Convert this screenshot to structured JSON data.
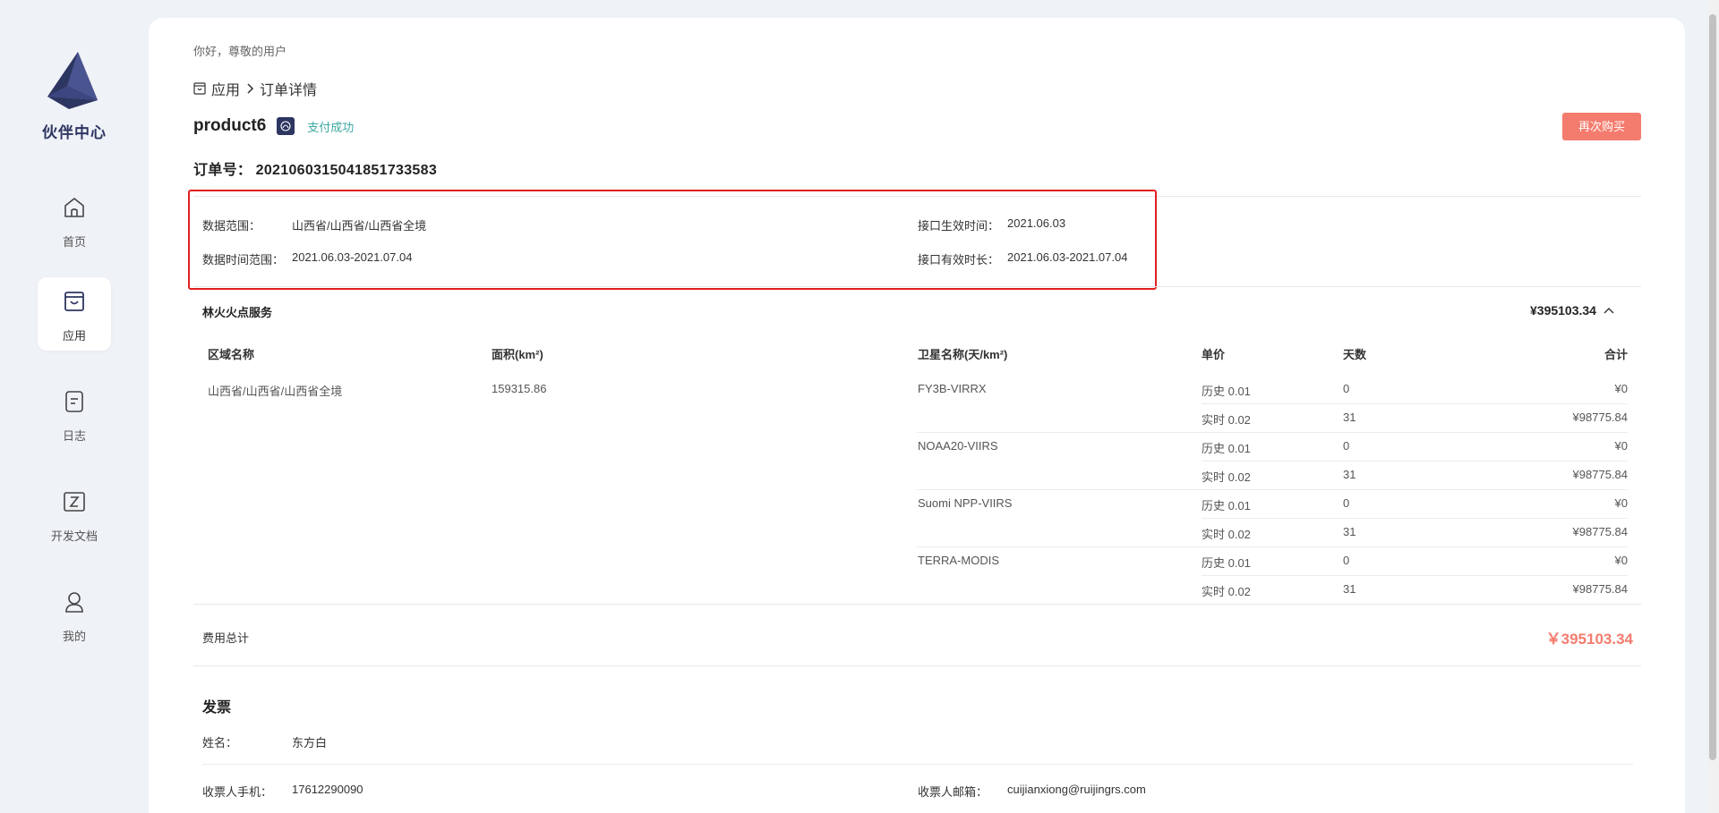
{
  "sidebar": {
    "brand": "伙伴中心",
    "items": [
      {
        "label": "首页",
        "icon": "home-icon"
      },
      {
        "label": "应用",
        "icon": "bag-icon",
        "active": true
      },
      {
        "label": "日志",
        "icon": "log-icon"
      },
      {
        "label": "开发文档",
        "icon": "doc-icon"
      },
      {
        "label": "我的",
        "icon": "user-icon"
      }
    ]
  },
  "header": {
    "greeting": "你好，尊敬的用户",
    "breadcrumb": {
      "root": "应用",
      "current": "订单详情"
    }
  },
  "product": {
    "name": "product6",
    "status": "支付成功",
    "rebuy_label": "再次购买"
  },
  "order": {
    "label": "订单号：",
    "number": "2021060315041851733583"
  },
  "info": {
    "data_range_label": "数据范围：",
    "data_range": "山西省/山西省/山西省全境",
    "data_time_label": "数据时间范围：",
    "data_time": "2021.06.03-2021.07.04",
    "api_start_label": "接口生效时间：",
    "api_start": "2021.06.03",
    "api_duration_label": "接口有效时长：",
    "api_duration": "2021.06.03-2021.07.04"
  },
  "service": {
    "title": "林火火点服务",
    "total": "¥395103.34",
    "headers": {
      "region": "区域名称",
      "area": "面积(km²)",
      "satellite": "卫星名称(天/km²)",
      "price": "单价",
      "days": "天数",
      "sum": "合计"
    },
    "region": "山西省/山西省/山西省全境",
    "area": "159315.86",
    "satellites": [
      {
        "name": "FY3B-VIRRX",
        "rows": [
          {
            "price": "历史 0.01",
            "days": "0",
            "sum": "¥0"
          },
          {
            "price": "实时 0.02",
            "days": "31",
            "sum": "¥98775.84"
          }
        ]
      },
      {
        "name": "NOAA20-VIIRS",
        "rows": [
          {
            "price": "历史 0.01",
            "days": "0",
            "sum": "¥0"
          },
          {
            "price": "实时 0.02",
            "days": "31",
            "sum": "¥98775.84"
          }
        ]
      },
      {
        "name": "Suomi NPP-VIIRS",
        "rows": [
          {
            "price": "历史 0.01",
            "days": "0",
            "sum": "¥0"
          },
          {
            "price": "实时 0.02",
            "days": "31",
            "sum": "¥98775.84"
          }
        ]
      },
      {
        "name": "TERRA-MODIS",
        "rows": [
          {
            "price": "历史 0.01",
            "days": "0",
            "sum": "¥0"
          },
          {
            "price": "实时 0.02",
            "days": "31",
            "sum": "¥98775.84"
          }
        ]
      }
    ]
  },
  "fee": {
    "label": "费用总计",
    "total": "￥395103.34"
  },
  "invoice": {
    "title": "发票",
    "name_label": "姓名：",
    "name": "东方白",
    "phone_label": "收票人手机：",
    "phone": "17612290090",
    "email_label": "收票人邮箱：",
    "email": "cuijianxiong@ruijingrs.com"
  },
  "colors": {
    "accent": "#f47c6e",
    "brand": "#2d3561",
    "status": "#3aa8a0",
    "highlight": "#e02020"
  }
}
